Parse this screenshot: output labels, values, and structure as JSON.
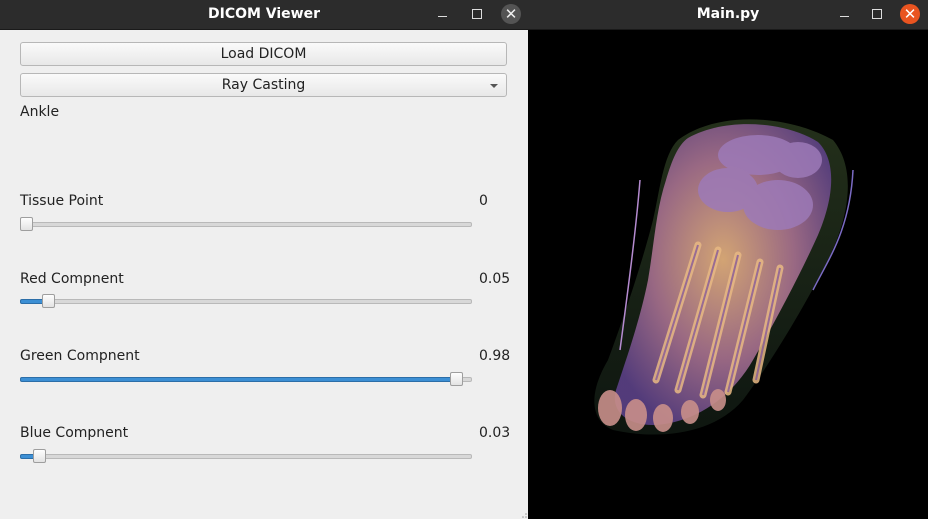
{
  "left_window": {
    "title": "DICOM Viewer",
    "load_button": "Load DICOM",
    "render_mode": "Ray Casting",
    "dataset_label": "Ankle",
    "sliders": [
      {
        "label": "Tissue Point",
        "value_text": "0",
        "level": 0.0
      },
      {
        "label": "Red Compnent",
        "value_text": "0.05",
        "level": 0.05
      },
      {
        "label": "Green Compnent",
        "value_text": "0.98",
        "level": 0.98
      },
      {
        "label": "Blue Compnent",
        "value_text": "0.03",
        "level": 0.03
      }
    ]
  },
  "right_window": {
    "title": "Main.py",
    "close_color": "#e95420"
  },
  "icons": {
    "minimize": "minimize-icon",
    "maximize": "maximize-icon",
    "close": "close-icon",
    "dropdown": "chevron-down-icon"
  },
  "colors": {
    "slider_fill": "#3c8fd4",
    "render_background": "#000000"
  }
}
